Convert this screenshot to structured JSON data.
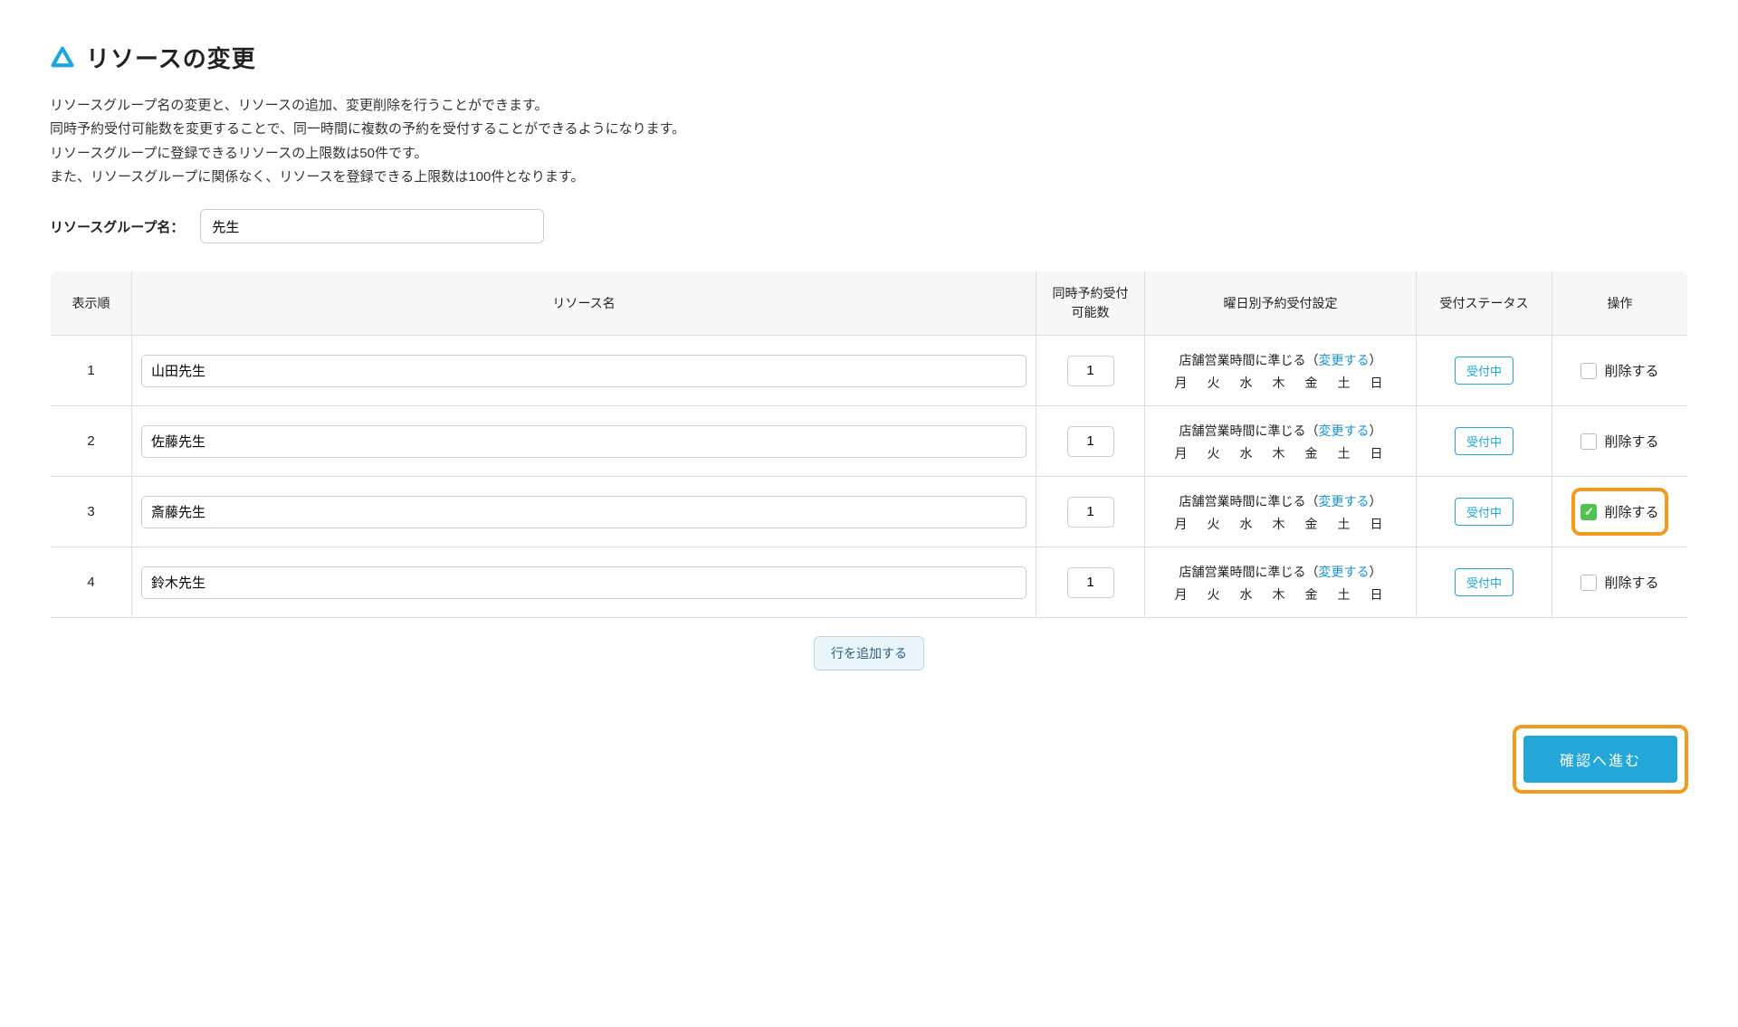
{
  "page": {
    "title": "リソースの変更",
    "description_lines": [
      "リソースグループ名の変更と、リソースの追加、変更削除を行うことができます。",
      "同時予約受付可能数を変更することで、同一時間に複数の予約を受付することができるようになります。",
      "リソースグループに登録できるリソースの上限数は50件です。",
      "また、リソースグループに関係なく、リソースを登録できる上限数は100件となります。"
    ]
  },
  "group": {
    "label": "リソースグループ名：",
    "value": "先生"
  },
  "table": {
    "headers": {
      "order": "表示順",
      "name": "リソース名",
      "capacity": "同時予約受付\n可能数",
      "schedule": "曜日別予約受付設定",
      "status": "受付ステータス",
      "action": "操作"
    },
    "schedule_prefix": "店舗営業時間に準じる（",
    "schedule_link": "変更する",
    "schedule_suffix": "）",
    "days": "月　火　水　木　金　土　日",
    "status_label": "受付中",
    "delete_label": "削除する",
    "add_row_label": "行を追加する",
    "rows": [
      {
        "order": "1",
        "name": "山田先生",
        "capacity": "1",
        "delete_checked": false,
        "highlighted": false
      },
      {
        "order": "2",
        "name": "佐藤先生",
        "capacity": "1",
        "delete_checked": false,
        "highlighted": false
      },
      {
        "order": "3",
        "name": "斎藤先生",
        "capacity": "1",
        "delete_checked": true,
        "highlighted": true
      },
      {
        "order": "4",
        "name": "鈴木先生",
        "capacity": "1",
        "delete_checked": false,
        "highlighted": false
      }
    ]
  },
  "confirm": {
    "label": "確認へ進む"
  }
}
